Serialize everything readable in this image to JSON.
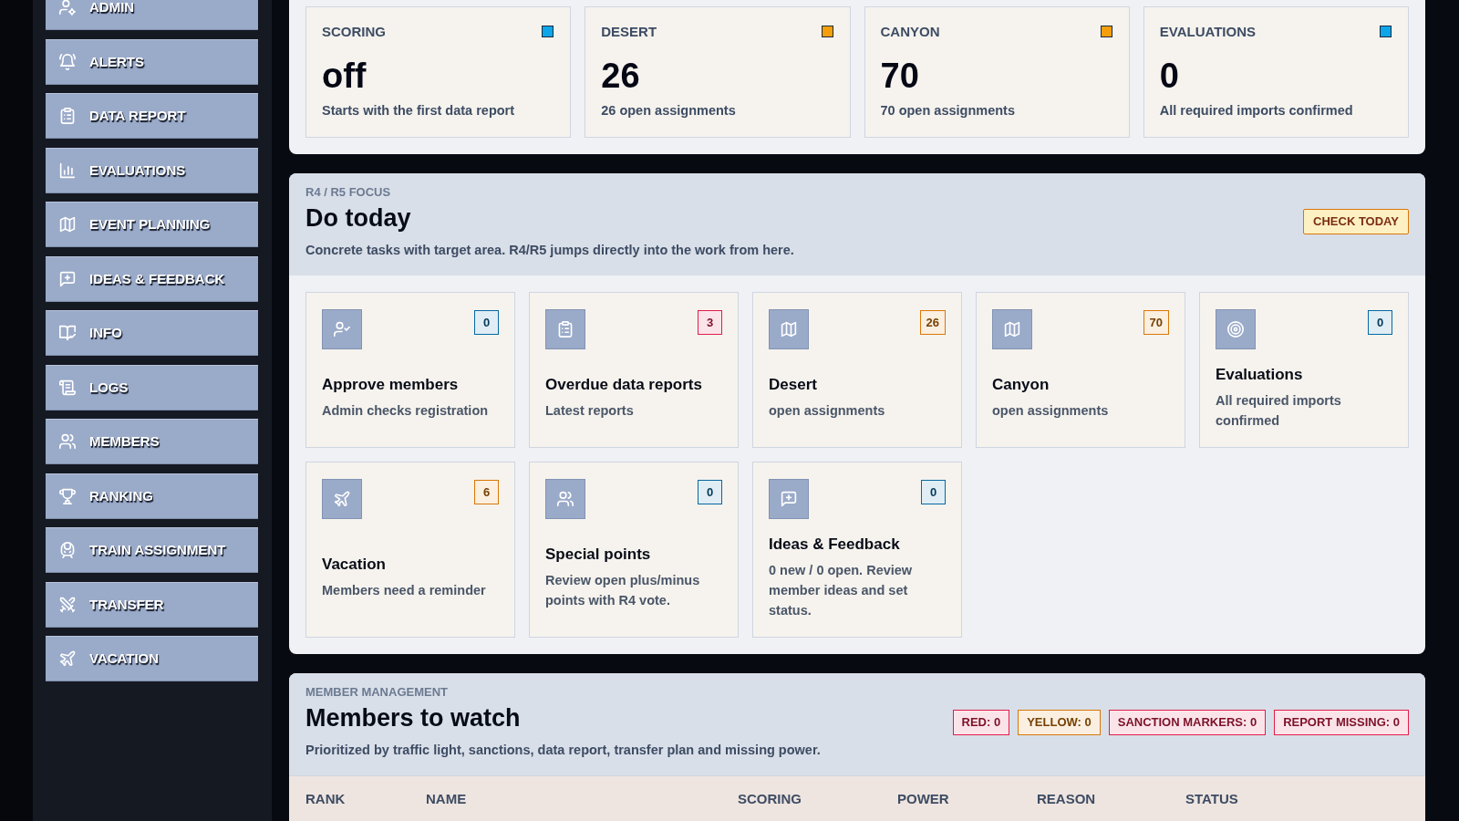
{
  "sidebar": {
    "items": [
      {
        "label": "ADMIN"
      },
      {
        "label": "ALERTS"
      },
      {
        "label": "DATA REPORT"
      },
      {
        "label": "EVALUATIONS"
      },
      {
        "label": "EVENT PLANNING"
      },
      {
        "label": "IDEAS & FEEDBACK"
      },
      {
        "label": "INFO"
      },
      {
        "label": "LOGS"
      },
      {
        "label": "MEMBERS"
      },
      {
        "label": "RANKING"
      },
      {
        "label": "TRAIN ASSIGNMENT"
      },
      {
        "label": "TRANSFER"
      },
      {
        "label": "VACATION"
      }
    ]
  },
  "stats": [
    {
      "label": "SCORING",
      "value": "off",
      "note": "Starts with the first data report",
      "color": "#0ea5e9"
    },
    {
      "label": "DESERT",
      "value": "26",
      "note": "26 open assignments",
      "color": "#f59e0b"
    },
    {
      "label": "CANYON",
      "value": "70",
      "note": "70 open assignments",
      "color": "#f59e0b"
    },
    {
      "label": "EVALUATIONS",
      "value": "0",
      "note": "All required imports confirmed",
      "color": "#0ea5e9"
    }
  ],
  "focus": {
    "eyebrow": "R4 / R5 FOCUS",
    "title": "Do today",
    "description": "Concrete tasks with target area. R4/R5 jumps directly into the work from here.",
    "button": "CHECK TODAY",
    "tasks": [
      {
        "title": "Approve members",
        "subtitle": "Admin checks registration",
        "count": "0",
        "color": "#0369a1"
      },
      {
        "title": "Overdue data reports",
        "subtitle": "Latest reports",
        "count": "3",
        "color": "#e11d48"
      },
      {
        "title": "Desert",
        "subtitle": "open assignments",
        "count": "26",
        "color": "#d97706"
      },
      {
        "title": "Canyon",
        "subtitle": "open assignments",
        "count": "70",
        "color": "#d97706"
      },
      {
        "title": "Evaluations",
        "subtitle": "All required imports confirmed",
        "count": "0",
        "color": "#0369a1"
      },
      {
        "title": "Vacation",
        "subtitle": "Members need a reminder",
        "count": "6",
        "color": "#d97706"
      },
      {
        "title": "Special points",
        "subtitle": "Review open plus/minus points with R4 vote.",
        "count": "0",
        "color": "#0369a1"
      },
      {
        "title": "Ideas & Feedback",
        "subtitle": "0 new / 0 open. Review member ideas and set status.",
        "count": "0",
        "color": "#0369a1"
      }
    ]
  },
  "watch": {
    "eyebrow": "MEMBER MANAGEMENT",
    "title": "Members to watch",
    "description": "Prioritized by traffic light, sanctions, data report, transfer plan and missing power.",
    "chips": [
      {
        "label": "RED: 0",
        "color": "#e11d48"
      },
      {
        "label": "YELLOW: 0",
        "color": "#d97706"
      },
      {
        "label": "SANCTION MARKERS: 0",
        "color": "#e11d48"
      },
      {
        "label": "REPORT MISSING: 0",
        "color": "#e11d48"
      }
    ],
    "table": {
      "columns": [
        "RANK",
        "NAME",
        "SCORING",
        "POWER",
        "REASON",
        "STATUS"
      ]
    }
  }
}
